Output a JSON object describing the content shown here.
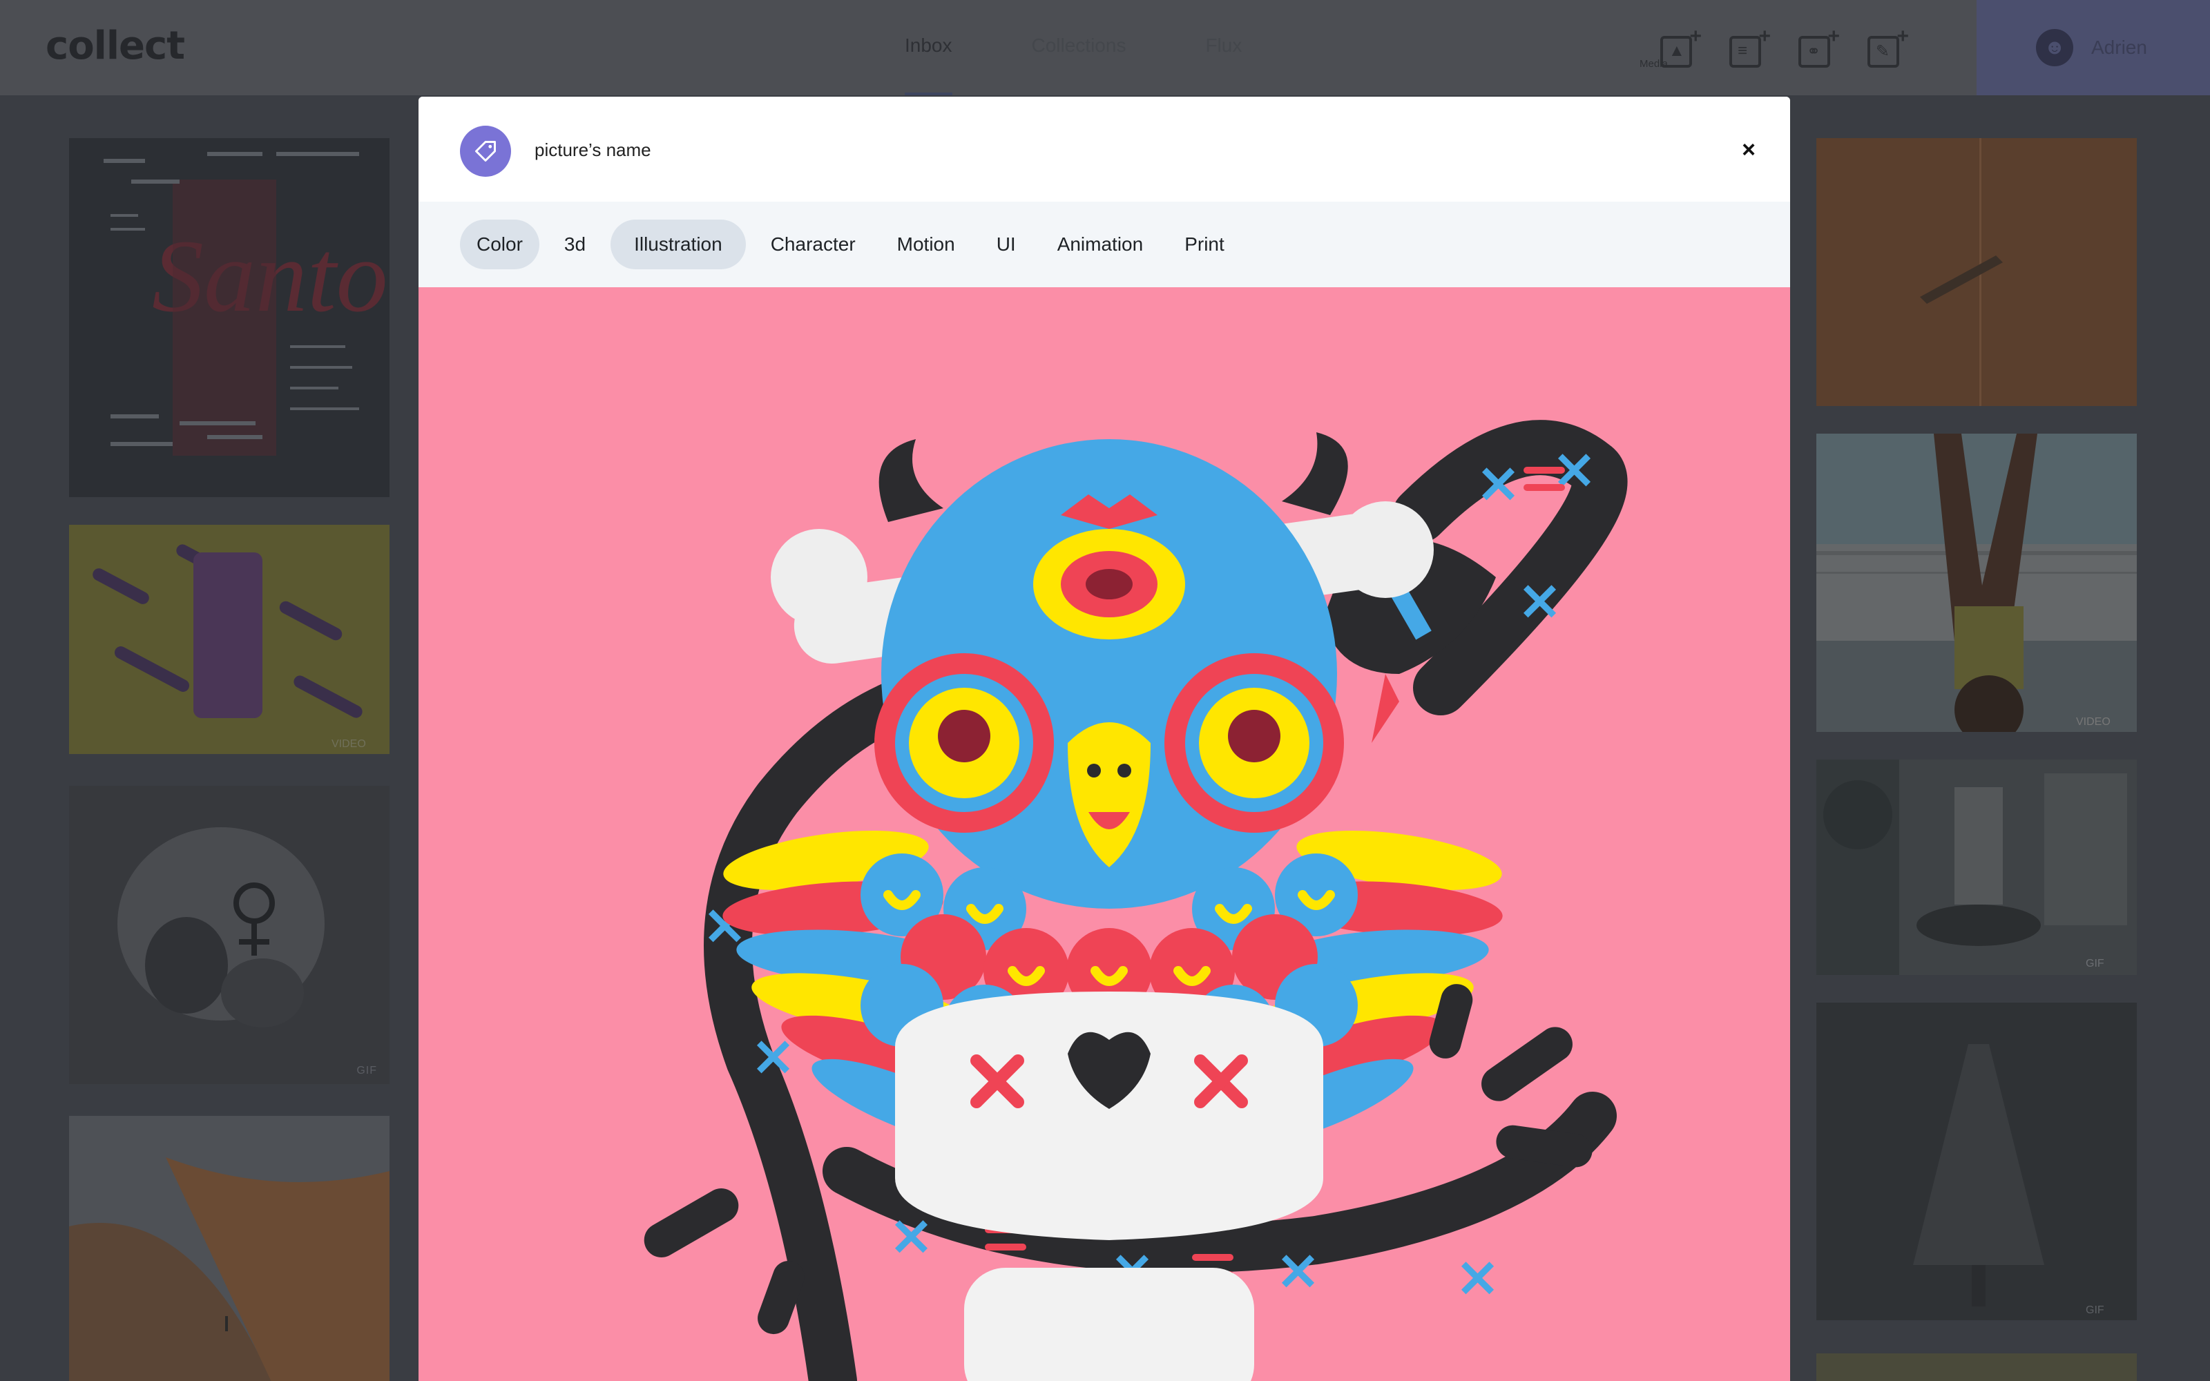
{
  "app": {
    "logo": "collect"
  },
  "nav": {
    "items": [
      "Inbox",
      "Collections",
      "Flux"
    ]
  },
  "toolbar": {
    "caption": "Media"
  },
  "user": {
    "name": "Adrien"
  },
  "modal": {
    "title": "picture’s name",
    "close_label": "×",
    "tags": [
      "Color",
      "3d",
      "Illustration",
      "Character",
      "Motion",
      "UI",
      "Animation",
      "Print"
    ],
    "selected_tags": [
      "Color",
      "Illustration"
    ]
  },
  "tiles": {
    "badge_video": "VIDEO",
    "badge_gif": "GIF"
  },
  "colors": {
    "tag_button": "#7a73d6",
    "image_bg": "#fb8ea7",
    "user_bg": "#4b4f6e"
  }
}
